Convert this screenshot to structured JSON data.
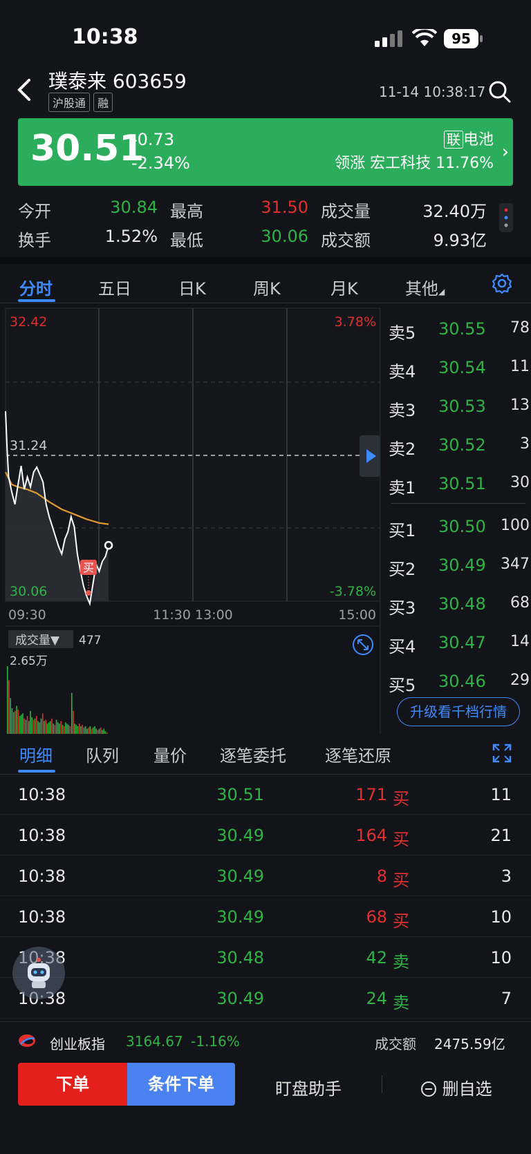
{
  "status_bar": {
    "time": "10:38",
    "battery": "95"
  },
  "header": {
    "title": "璞泰来 603659",
    "tags": [
      "沪股通",
      "融"
    ],
    "datetime": "11-14 10:38:17"
  },
  "quote": {
    "price": "30.51",
    "change": "-0.73",
    "change_pct": "-2.34%",
    "sector_badge": "联",
    "sector": "电池",
    "leader_label": "领涨",
    "leader_name": "宏工科技",
    "leader_pct": "11.76%",
    "banner_color": "#2bad5c"
  },
  "stats": {
    "open_label": "今开",
    "open": "30.84",
    "high_label": "最高",
    "high": "31.50",
    "volume_label": "成交量",
    "volume": "32.40万",
    "turnover_label": "换手",
    "turnover": "1.52%",
    "low_label": "最低",
    "low": "30.06",
    "amount_label": "成交额",
    "amount": "9.93亿"
  },
  "tabs": [
    "分时",
    "五日",
    "日K",
    "周K",
    "月K",
    "其他"
  ],
  "active_tab": "分时",
  "chart": {
    "top_price": "32.42",
    "top_pct": "3.78%",
    "mid_price": "31.24",
    "bottom_price": "30.06",
    "bottom_pct": "-3.78%",
    "x_labels": [
      "09:30",
      "11:30 13:00",
      "15:00"
    ],
    "buy_marker": "买",
    "volume_selector": "成交量▼",
    "volume_value": "477",
    "volume_max": "2.65万"
  },
  "chart_data": {
    "type": "line",
    "ylim": [
      30.06,
      32.42
    ],
    "x_range_minutes": [
      0,
      240
    ],
    "series": [
      {
        "name": "price",
        "color": "#ffffff",
        "points": [
          [
            0,
            31.59
          ],
          [
            1,
            31.28
          ],
          [
            2,
            31.06
          ],
          [
            4,
            30.94
          ],
          [
            6,
            30.84
          ],
          [
            8,
            31.0
          ],
          [
            10,
            31.15
          ],
          [
            12,
            30.96
          ],
          [
            14,
            31.06
          ],
          [
            16,
            30.98
          ],
          [
            18,
            31.1
          ],
          [
            20,
            31.14
          ],
          [
            22,
            31.08
          ],
          [
            24,
            31.02
          ],
          [
            26,
            30.84
          ],
          [
            28,
            30.74
          ],
          [
            30,
            30.66
          ],
          [
            32,
            30.58
          ],
          [
            34,
            30.5
          ],
          [
            36,
            30.44
          ],
          [
            38,
            30.56
          ],
          [
            40,
            30.62
          ],
          [
            42,
            30.74
          ],
          [
            44,
            30.66
          ],
          [
            46,
            30.44
          ],
          [
            48,
            30.3
          ],
          [
            50,
            30.18
          ],
          [
            52,
            30.1
          ],
          [
            54,
            30.04
          ],
          [
            56,
            30.2
          ],
          [
            58,
            30.36
          ],
          [
            60,
            30.3
          ],
          [
            62,
            30.38
          ],
          [
            64,
            30.42
          ],
          [
            66,
            30.51
          ]
        ]
      },
      {
        "name": "avg",
        "color": "#e29a2f",
        "points": [
          [
            0,
            31.1
          ],
          [
            4,
            31.0
          ],
          [
            8,
            30.98
          ],
          [
            14,
            30.96
          ],
          [
            20,
            30.93
          ],
          [
            28,
            30.86
          ],
          [
            36,
            30.8
          ],
          [
            44,
            30.76
          ],
          [
            52,
            30.72
          ],
          [
            60,
            30.69
          ],
          [
            66,
            30.68
          ]
        ]
      }
    ],
    "volume": [
      2.65,
      2.1,
      1.4,
      1.0,
      0.85,
      0.9,
      1.1,
      0.95,
      0.7,
      0.75,
      0.8,
      0.6,
      0.55,
      0.7,
      0.5,
      0.9,
      0.65,
      0.55,
      0.6,
      0.7,
      0.5,
      0.45,
      0.6,
      0.8,
      0.5,
      0.55,
      0.4,
      0.45,
      0.5,
      0.6,
      0.4,
      0.35,
      0.55,
      0.45,
      0.4,
      0.5,
      0.35,
      0.3,
      0.45,
      0.4,
      0.35,
      0.3,
      1.6,
      0.9,
      0.4,
      0.35,
      0.3,
      0.4,
      0.3,
      0.35,
      0.25,
      0.3,
      0.2,
      0.25,
      0.3,
      0.2,
      0.25,
      0.3,
      0.2,
      0.15,
      0.2,
      0.25,
      0.15,
      0.2,
      0.1,
      0.05
    ]
  },
  "order_book": {
    "sell": [
      {
        "label": "卖5",
        "price": "30.55",
        "vol": "78"
      },
      {
        "label": "卖4",
        "price": "30.54",
        "vol": "11"
      },
      {
        "label": "卖3",
        "price": "30.53",
        "vol": "13"
      },
      {
        "label": "卖2",
        "price": "30.52",
        "vol": "3"
      },
      {
        "label": "卖1",
        "price": "30.51",
        "vol": "30"
      }
    ],
    "buy": [
      {
        "label": "买1",
        "price": "30.50",
        "vol": "100"
      },
      {
        "label": "买2",
        "price": "30.49",
        "vol": "347"
      },
      {
        "label": "买3",
        "price": "30.48",
        "vol": "68"
      },
      {
        "label": "买4",
        "price": "30.47",
        "vol": "14"
      },
      {
        "label": "买5",
        "price": "30.46",
        "vol": "29"
      }
    ],
    "upgrade_label": "升级看千档行情"
  },
  "detail_tabs": [
    "明细",
    "队列",
    "量价",
    "逐笔委托",
    "逐笔还原"
  ],
  "trades": [
    {
      "time": "10:38",
      "price": "30.51",
      "vol": "171",
      "side": "买",
      "count": "11"
    },
    {
      "time": "10:38",
      "price": "30.49",
      "vol": "164",
      "side": "买",
      "count": "21"
    },
    {
      "time": "10:38",
      "price": "30.49",
      "vol": "8",
      "side": "买",
      "count": "3"
    },
    {
      "time": "10:38",
      "price": "30.49",
      "vol": "68",
      "side": "买",
      "count": "10"
    },
    {
      "time": "10:38",
      "price": "30.48",
      "vol": "42",
      "side": "卖",
      "count": "10"
    },
    {
      "time": "10:38",
      "price": "30.49",
      "vol": "24",
      "side": "卖",
      "count": "7"
    }
  ],
  "index_bar": {
    "name": "创业板指",
    "value": "3164.67",
    "pct": "-1.16%",
    "amount_label": "成交额",
    "amount": "2475.59亿"
  },
  "bottom_bar": {
    "order": "下单",
    "conditional": "条件下单",
    "assistant": "盯盘助手",
    "remove": "删自选"
  }
}
